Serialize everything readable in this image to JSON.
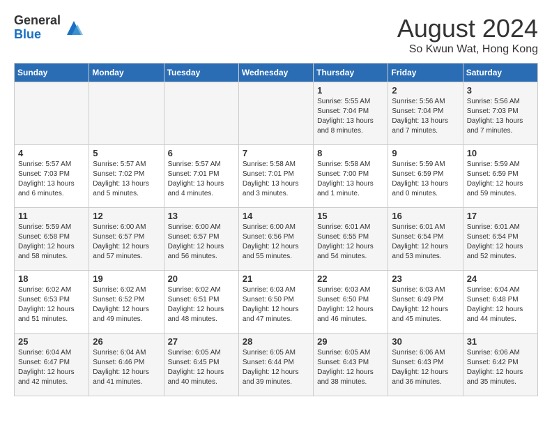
{
  "logo": {
    "general": "General",
    "blue": "Blue"
  },
  "title": "August 2024",
  "location": "So Kwun Wat, Hong Kong",
  "days_of_week": [
    "Sunday",
    "Monday",
    "Tuesday",
    "Wednesday",
    "Thursday",
    "Friday",
    "Saturday"
  ],
  "weeks": [
    [
      {
        "day": "",
        "info": ""
      },
      {
        "day": "",
        "info": ""
      },
      {
        "day": "",
        "info": ""
      },
      {
        "day": "",
        "info": ""
      },
      {
        "day": "1",
        "info": "Sunrise: 5:55 AM\nSunset: 7:04 PM\nDaylight: 13 hours\nand 8 minutes."
      },
      {
        "day": "2",
        "info": "Sunrise: 5:56 AM\nSunset: 7:04 PM\nDaylight: 13 hours\nand 7 minutes."
      },
      {
        "day": "3",
        "info": "Sunrise: 5:56 AM\nSunset: 7:03 PM\nDaylight: 13 hours\nand 7 minutes."
      }
    ],
    [
      {
        "day": "4",
        "info": "Sunrise: 5:57 AM\nSunset: 7:03 PM\nDaylight: 13 hours\nand 6 minutes."
      },
      {
        "day": "5",
        "info": "Sunrise: 5:57 AM\nSunset: 7:02 PM\nDaylight: 13 hours\nand 5 minutes."
      },
      {
        "day": "6",
        "info": "Sunrise: 5:57 AM\nSunset: 7:01 PM\nDaylight: 13 hours\nand 4 minutes."
      },
      {
        "day": "7",
        "info": "Sunrise: 5:58 AM\nSunset: 7:01 PM\nDaylight: 13 hours\nand 3 minutes."
      },
      {
        "day": "8",
        "info": "Sunrise: 5:58 AM\nSunset: 7:00 PM\nDaylight: 13 hours\nand 1 minute."
      },
      {
        "day": "9",
        "info": "Sunrise: 5:59 AM\nSunset: 6:59 PM\nDaylight: 13 hours\nand 0 minutes."
      },
      {
        "day": "10",
        "info": "Sunrise: 5:59 AM\nSunset: 6:59 PM\nDaylight: 12 hours\nand 59 minutes."
      }
    ],
    [
      {
        "day": "11",
        "info": "Sunrise: 5:59 AM\nSunset: 6:58 PM\nDaylight: 12 hours\nand 58 minutes."
      },
      {
        "day": "12",
        "info": "Sunrise: 6:00 AM\nSunset: 6:57 PM\nDaylight: 12 hours\nand 57 minutes."
      },
      {
        "day": "13",
        "info": "Sunrise: 6:00 AM\nSunset: 6:57 PM\nDaylight: 12 hours\nand 56 minutes."
      },
      {
        "day": "14",
        "info": "Sunrise: 6:00 AM\nSunset: 6:56 PM\nDaylight: 12 hours\nand 55 minutes."
      },
      {
        "day": "15",
        "info": "Sunrise: 6:01 AM\nSunset: 6:55 PM\nDaylight: 12 hours\nand 54 minutes."
      },
      {
        "day": "16",
        "info": "Sunrise: 6:01 AM\nSunset: 6:54 PM\nDaylight: 12 hours\nand 53 minutes."
      },
      {
        "day": "17",
        "info": "Sunrise: 6:01 AM\nSunset: 6:54 PM\nDaylight: 12 hours\nand 52 minutes."
      }
    ],
    [
      {
        "day": "18",
        "info": "Sunrise: 6:02 AM\nSunset: 6:53 PM\nDaylight: 12 hours\nand 51 minutes."
      },
      {
        "day": "19",
        "info": "Sunrise: 6:02 AM\nSunset: 6:52 PM\nDaylight: 12 hours\nand 49 minutes."
      },
      {
        "day": "20",
        "info": "Sunrise: 6:02 AM\nSunset: 6:51 PM\nDaylight: 12 hours\nand 48 minutes."
      },
      {
        "day": "21",
        "info": "Sunrise: 6:03 AM\nSunset: 6:50 PM\nDaylight: 12 hours\nand 47 minutes."
      },
      {
        "day": "22",
        "info": "Sunrise: 6:03 AM\nSunset: 6:50 PM\nDaylight: 12 hours\nand 46 minutes."
      },
      {
        "day": "23",
        "info": "Sunrise: 6:03 AM\nSunset: 6:49 PM\nDaylight: 12 hours\nand 45 minutes."
      },
      {
        "day": "24",
        "info": "Sunrise: 6:04 AM\nSunset: 6:48 PM\nDaylight: 12 hours\nand 44 minutes."
      }
    ],
    [
      {
        "day": "25",
        "info": "Sunrise: 6:04 AM\nSunset: 6:47 PM\nDaylight: 12 hours\nand 42 minutes."
      },
      {
        "day": "26",
        "info": "Sunrise: 6:04 AM\nSunset: 6:46 PM\nDaylight: 12 hours\nand 41 minutes."
      },
      {
        "day": "27",
        "info": "Sunrise: 6:05 AM\nSunset: 6:45 PM\nDaylight: 12 hours\nand 40 minutes."
      },
      {
        "day": "28",
        "info": "Sunrise: 6:05 AM\nSunset: 6:44 PM\nDaylight: 12 hours\nand 39 minutes."
      },
      {
        "day": "29",
        "info": "Sunrise: 6:05 AM\nSunset: 6:43 PM\nDaylight: 12 hours\nand 38 minutes."
      },
      {
        "day": "30",
        "info": "Sunrise: 6:06 AM\nSunset: 6:43 PM\nDaylight: 12 hours\nand 36 minutes."
      },
      {
        "day": "31",
        "info": "Sunrise: 6:06 AM\nSunset: 6:42 PM\nDaylight: 12 hours\nand 35 minutes."
      }
    ]
  ]
}
